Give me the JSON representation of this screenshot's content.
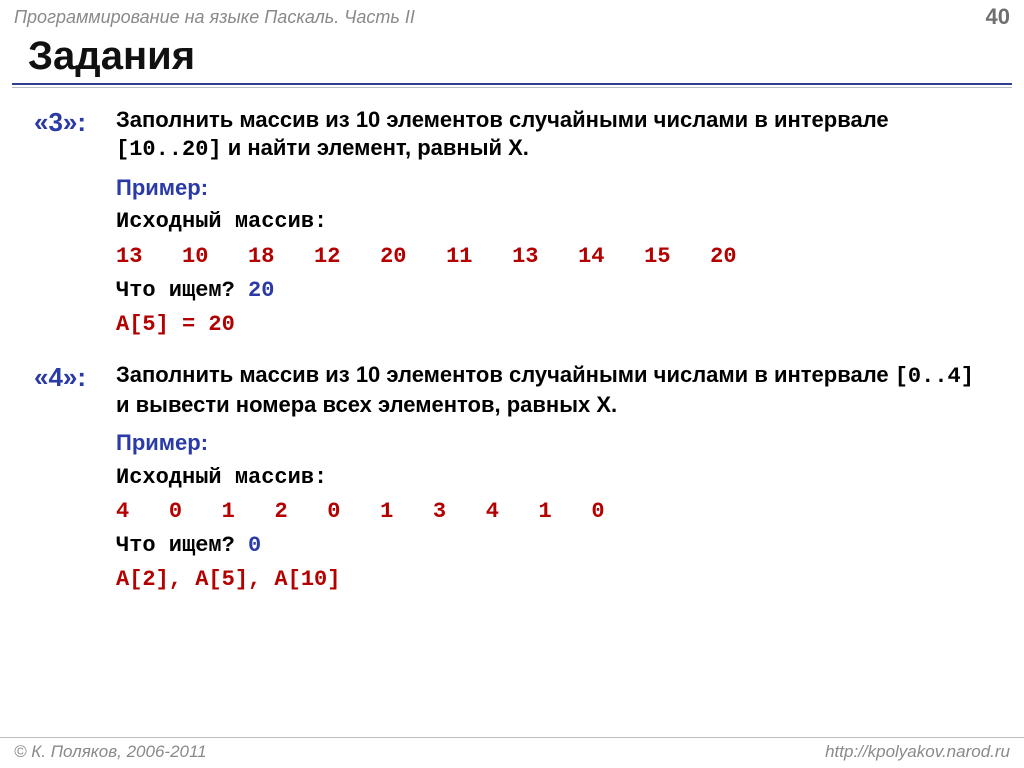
{
  "header": {
    "course": "Программирование на языке Паскаль. Часть II",
    "page": "40"
  },
  "title": "Задания",
  "tasks": [
    {
      "grade": "«3»:",
      "desc_pre": "Заполнить массив из 10 элементов случайными числами в интервале ",
      "interval": "[10..20]",
      "desc_post": " и найти элемент, равный X.",
      "example_label": "Пример:",
      "src_label": "Исходный массив:",
      "array": [
        "13",
        "10",
        "18",
        "12",
        "20",
        "11",
        "13",
        "14",
        "15",
        "20"
      ],
      "q_label": "Что ищем? ",
      "q_value": "20",
      "answer": "A[5] = 20"
    },
    {
      "grade": "«4»:",
      "desc_pre": "Заполнить массив из 10 элементов случайными числами в интервале ",
      "interval": "[0..4]",
      "desc_post": " и вывести номера всех элементов, равных X.",
      "example_label": "Пример:",
      "src_label": "Исходный массив:",
      "array": [
        "4",
        "0",
        "1",
        "2",
        "0",
        "1",
        "3",
        "4",
        "1",
        "0"
      ],
      "q_label": "Что ищем? ",
      "q_value": "0",
      "answer": "A[2], A[5], A[10]"
    }
  ],
  "footer": {
    "copyright": "© К. Поляков, 2006-2011",
    "url": "http://kpolyakov.narod.ru"
  }
}
